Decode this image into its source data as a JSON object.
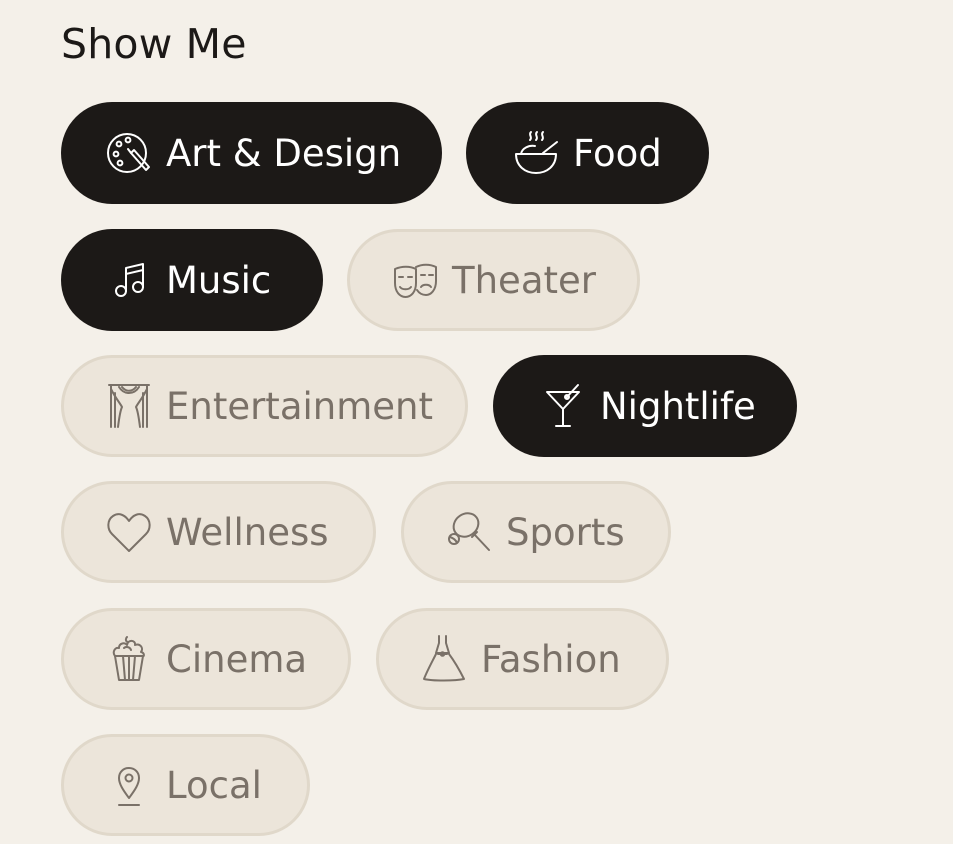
{
  "section": {
    "title": "Show Me"
  },
  "colors": {
    "background": "#f4f0e9",
    "selected_fill": "#1c1917",
    "selected_text": "#ffffff",
    "unselected_fill": "#ece5da",
    "unselected_border": "#e0d8ca",
    "unselected_text": "#7a7168"
  },
  "categories": [
    {
      "label": "Art & Design",
      "icon": "palette-icon",
      "selected": true
    },
    {
      "label": "Food",
      "icon": "soup-bowl-icon",
      "selected": true
    },
    {
      "label": "Music",
      "icon": "music-note-icon",
      "selected": true
    },
    {
      "label": "Theater",
      "icon": "theater-masks-icon",
      "selected": false
    },
    {
      "label": "Entertainment",
      "icon": "stage-curtains-icon",
      "selected": false
    },
    {
      "label": "Nightlife",
      "icon": "cocktail-glass-icon",
      "selected": true
    },
    {
      "label": "Wellness",
      "icon": "heart-icon",
      "selected": false
    },
    {
      "label": "Sports",
      "icon": "racket-ball-icon",
      "selected": false
    },
    {
      "label": "Cinema",
      "icon": "popcorn-icon",
      "selected": false
    },
    {
      "label": "Fashion",
      "icon": "dress-icon",
      "selected": false
    },
    {
      "label": "Local",
      "icon": "location-pin-icon",
      "selected": false
    }
  ]
}
